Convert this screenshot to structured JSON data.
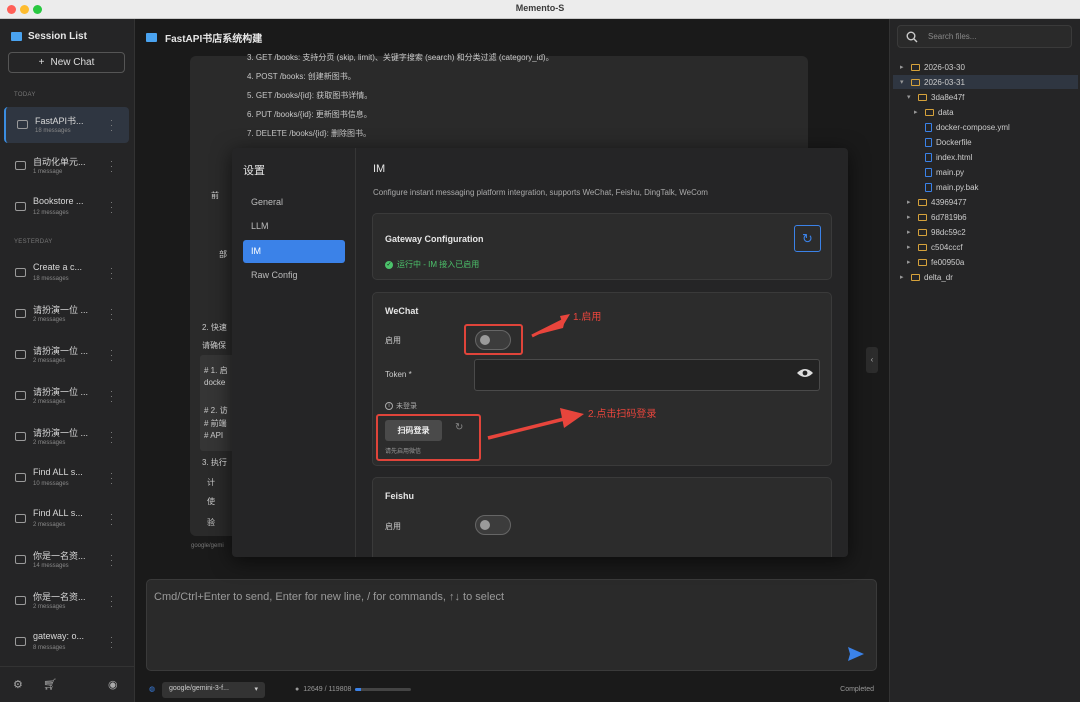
{
  "window": {
    "title": "Memento-S"
  },
  "left": {
    "title": "Session List",
    "new_chat": "New Chat",
    "groups": {
      "today": "TODAY",
      "yesterday": "YESTERDAY"
    },
    "sessions": [
      {
        "title": "FastAPI书...",
        "meta": "18 messages"
      },
      {
        "title": "自动化单元...",
        "meta": "1 message"
      },
      {
        "title": "Bookstore ...",
        "meta": "12 messages"
      },
      {
        "title": "Create a c...",
        "meta": "18 messages"
      },
      {
        "title": "请扮演一位 ...",
        "meta": "2 messages"
      },
      {
        "title": "请扮演一位 ...",
        "meta": "2 messages"
      },
      {
        "title": "请扮演一位 ...",
        "meta": "2 messages"
      },
      {
        "title": "请扮演一位 ...",
        "meta": "2 messages"
      },
      {
        "title": "Find ALL s...",
        "meta": "10 messages"
      },
      {
        "title": "Find ALL s...",
        "meta": "2 messages"
      },
      {
        "title": "你是一名资...",
        "meta": "14 messages"
      },
      {
        "title": "你是一名资...",
        "meta": "2 messages"
      },
      {
        "title": "gateway: o...",
        "meta": "8 messages"
      }
    ]
  },
  "center": {
    "title": "FastAPI书店系统构建",
    "lines": [
      "3. GET /books: 支持分页 (skip, limit)、关键字搜索 (search) 和分类过滤 (category_id)。",
      "4. POST /books: 创建新图书。",
      "5. GET /books/{id}: 获取图书详情。",
      "6. PUT /books/{id}: 更新图书信息。",
      "7. DELETE /books/{id}: 删除图书。"
    ],
    "side_text": [
      "前",
      "部",
      "2. 快速",
      "请确保",
      "# 1. 启",
      "docke",
      "# 2. 访",
      "# 前端",
      "# API",
      "3. 执行",
      "计",
      "使",
      "验"
    ],
    "footer_model": "google/gemi",
    "input_placeholder": "Cmd/Ctrl+Enter to send, Enter for new line, / for commands, ↑↓ to select",
    "model": "google/gemini-3-f...",
    "tokens": "12649 / 119808",
    "token_ratio": 0.106,
    "status": "Completed"
  },
  "modal": {
    "title": "设置",
    "nav": [
      "General",
      "LLM",
      "IM",
      "Raw Config"
    ],
    "active": "IM",
    "heading": "IM",
    "description": "Configure instant messaging platform integration, supports WeChat, Feishu, DingTalk, WeCom",
    "gateway": {
      "title": "Gateway Configuration",
      "status": "运行中 - IM 接入已启用"
    },
    "wechat": {
      "title": "WeChat",
      "enable_label": "启用",
      "token_label": "Token *",
      "login_status": "未登录",
      "scan_button": "扫码登录",
      "hint": "请先启用微信"
    },
    "feishu": {
      "title": "Feishu",
      "enable_label": "启用"
    }
  },
  "annotations": {
    "step1": "1.启用",
    "step2": "2.点击扫码登录"
  },
  "right": {
    "search_placeholder": "Search files...",
    "tree": [
      {
        "name": "2026-03-30",
        "type": "folder",
        "depth": 0,
        "open": false
      },
      {
        "name": "2026-03-31",
        "type": "folder",
        "depth": 0,
        "open": true
      },
      {
        "name": "3da8e47f",
        "type": "folder",
        "depth": 1,
        "open": true
      },
      {
        "name": "data",
        "type": "folder",
        "depth": 2,
        "open": false
      },
      {
        "name": "docker-compose.yml",
        "type": "file",
        "depth": 2
      },
      {
        "name": "Dockerfile",
        "type": "file",
        "depth": 2
      },
      {
        "name": "index.html",
        "type": "file",
        "depth": 2
      },
      {
        "name": "main.py",
        "type": "file",
        "depth": 2
      },
      {
        "name": "main.py.bak",
        "type": "file",
        "depth": 2
      },
      {
        "name": "43969477",
        "type": "folder",
        "depth": 1,
        "open": false
      },
      {
        "name": "6d7819b6",
        "type": "folder",
        "depth": 1,
        "open": false
      },
      {
        "name": "98dc59c2",
        "type": "folder",
        "depth": 1,
        "open": false
      },
      {
        "name": "c504cccf",
        "type": "folder",
        "depth": 1,
        "open": false
      },
      {
        "name": "fe00950a",
        "type": "folder",
        "depth": 1,
        "open": false
      },
      {
        "name": "delta_dr",
        "type": "folder",
        "depth": 0,
        "open": false
      }
    ]
  },
  "colors": {
    "accent": "#3b82e8",
    "success": "#4cc26b",
    "annotation": "#e8453c",
    "folder": "#d6a23b"
  }
}
